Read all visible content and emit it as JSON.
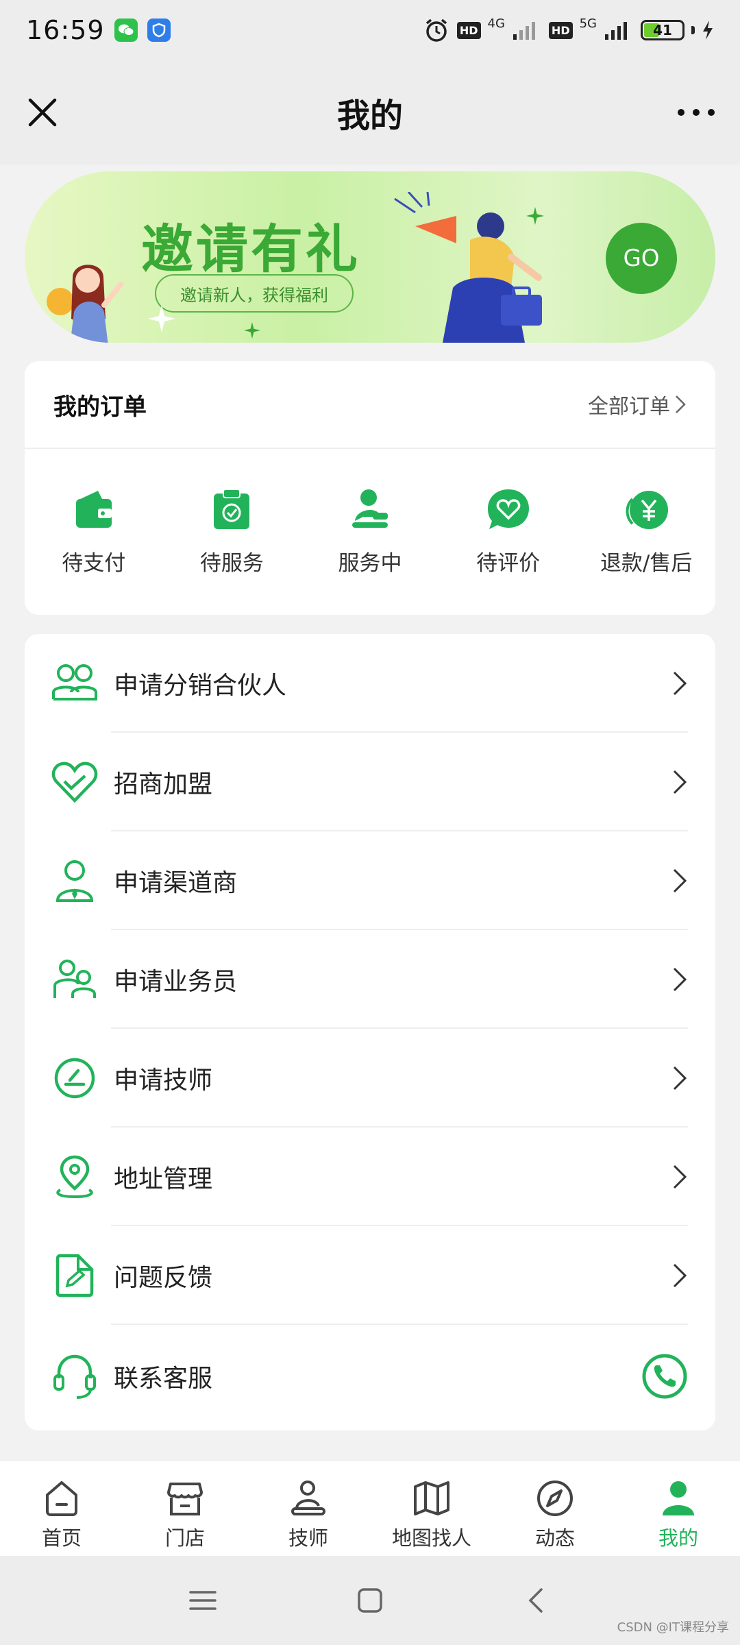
{
  "status_bar": {
    "time": "16:59",
    "network_a": "4G",
    "network_b": "5G",
    "hd": "HD",
    "battery": "41"
  },
  "header": {
    "title": "我的"
  },
  "banner": {
    "title": "邀请有礼",
    "subtitle": "邀请新人，获得福利",
    "go_label": "GO"
  },
  "orders": {
    "title": "我的订单",
    "all_label": "全部订单",
    "items": [
      {
        "label": "待支付",
        "icon": "wallet-icon"
      },
      {
        "label": "待服务",
        "icon": "clipboard-check-icon"
      },
      {
        "label": "服务中",
        "icon": "service-person-icon"
      },
      {
        "label": "待评价",
        "icon": "heart-chat-icon"
      },
      {
        "label": "退款/售后",
        "icon": "refund-yen-icon"
      }
    ]
  },
  "menu": {
    "items": [
      {
        "label": "申请分销合伙人",
        "icon": "partners-icon"
      },
      {
        "label": "招商加盟",
        "icon": "heart-handshake-icon"
      },
      {
        "label": "申请渠道商",
        "icon": "agent-icon"
      },
      {
        "label": "申请业务员",
        "icon": "staff-icon"
      },
      {
        "label": "申请技师",
        "icon": "technician-icon"
      },
      {
        "label": "地址管理",
        "icon": "location-icon"
      },
      {
        "label": "问题反馈",
        "icon": "feedback-icon"
      },
      {
        "label": "联系客服",
        "icon": "headset-icon"
      }
    ]
  },
  "tabbar": {
    "items": [
      {
        "label": "首页",
        "icon": "home-icon",
        "active": false
      },
      {
        "label": "门店",
        "icon": "store-icon",
        "active": false
      },
      {
        "label": "技师",
        "icon": "technician-tab-icon",
        "active": false
      },
      {
        "label": "地图找人",
        "icon": "map-icon",
        "active": false
      },
      {
        "label": "动态",
        "icon": "compass-icon",
        "active": false
      },
      {
        "label": "我的",
        "icon": "user-icon",
        "active": true
      }
    ]
  },
  "watermark": "CSDN @IT课程分享",
  "colors": {
    "accent": "#22b35a",
    "banner_green": "#3aa935"
  }
}
